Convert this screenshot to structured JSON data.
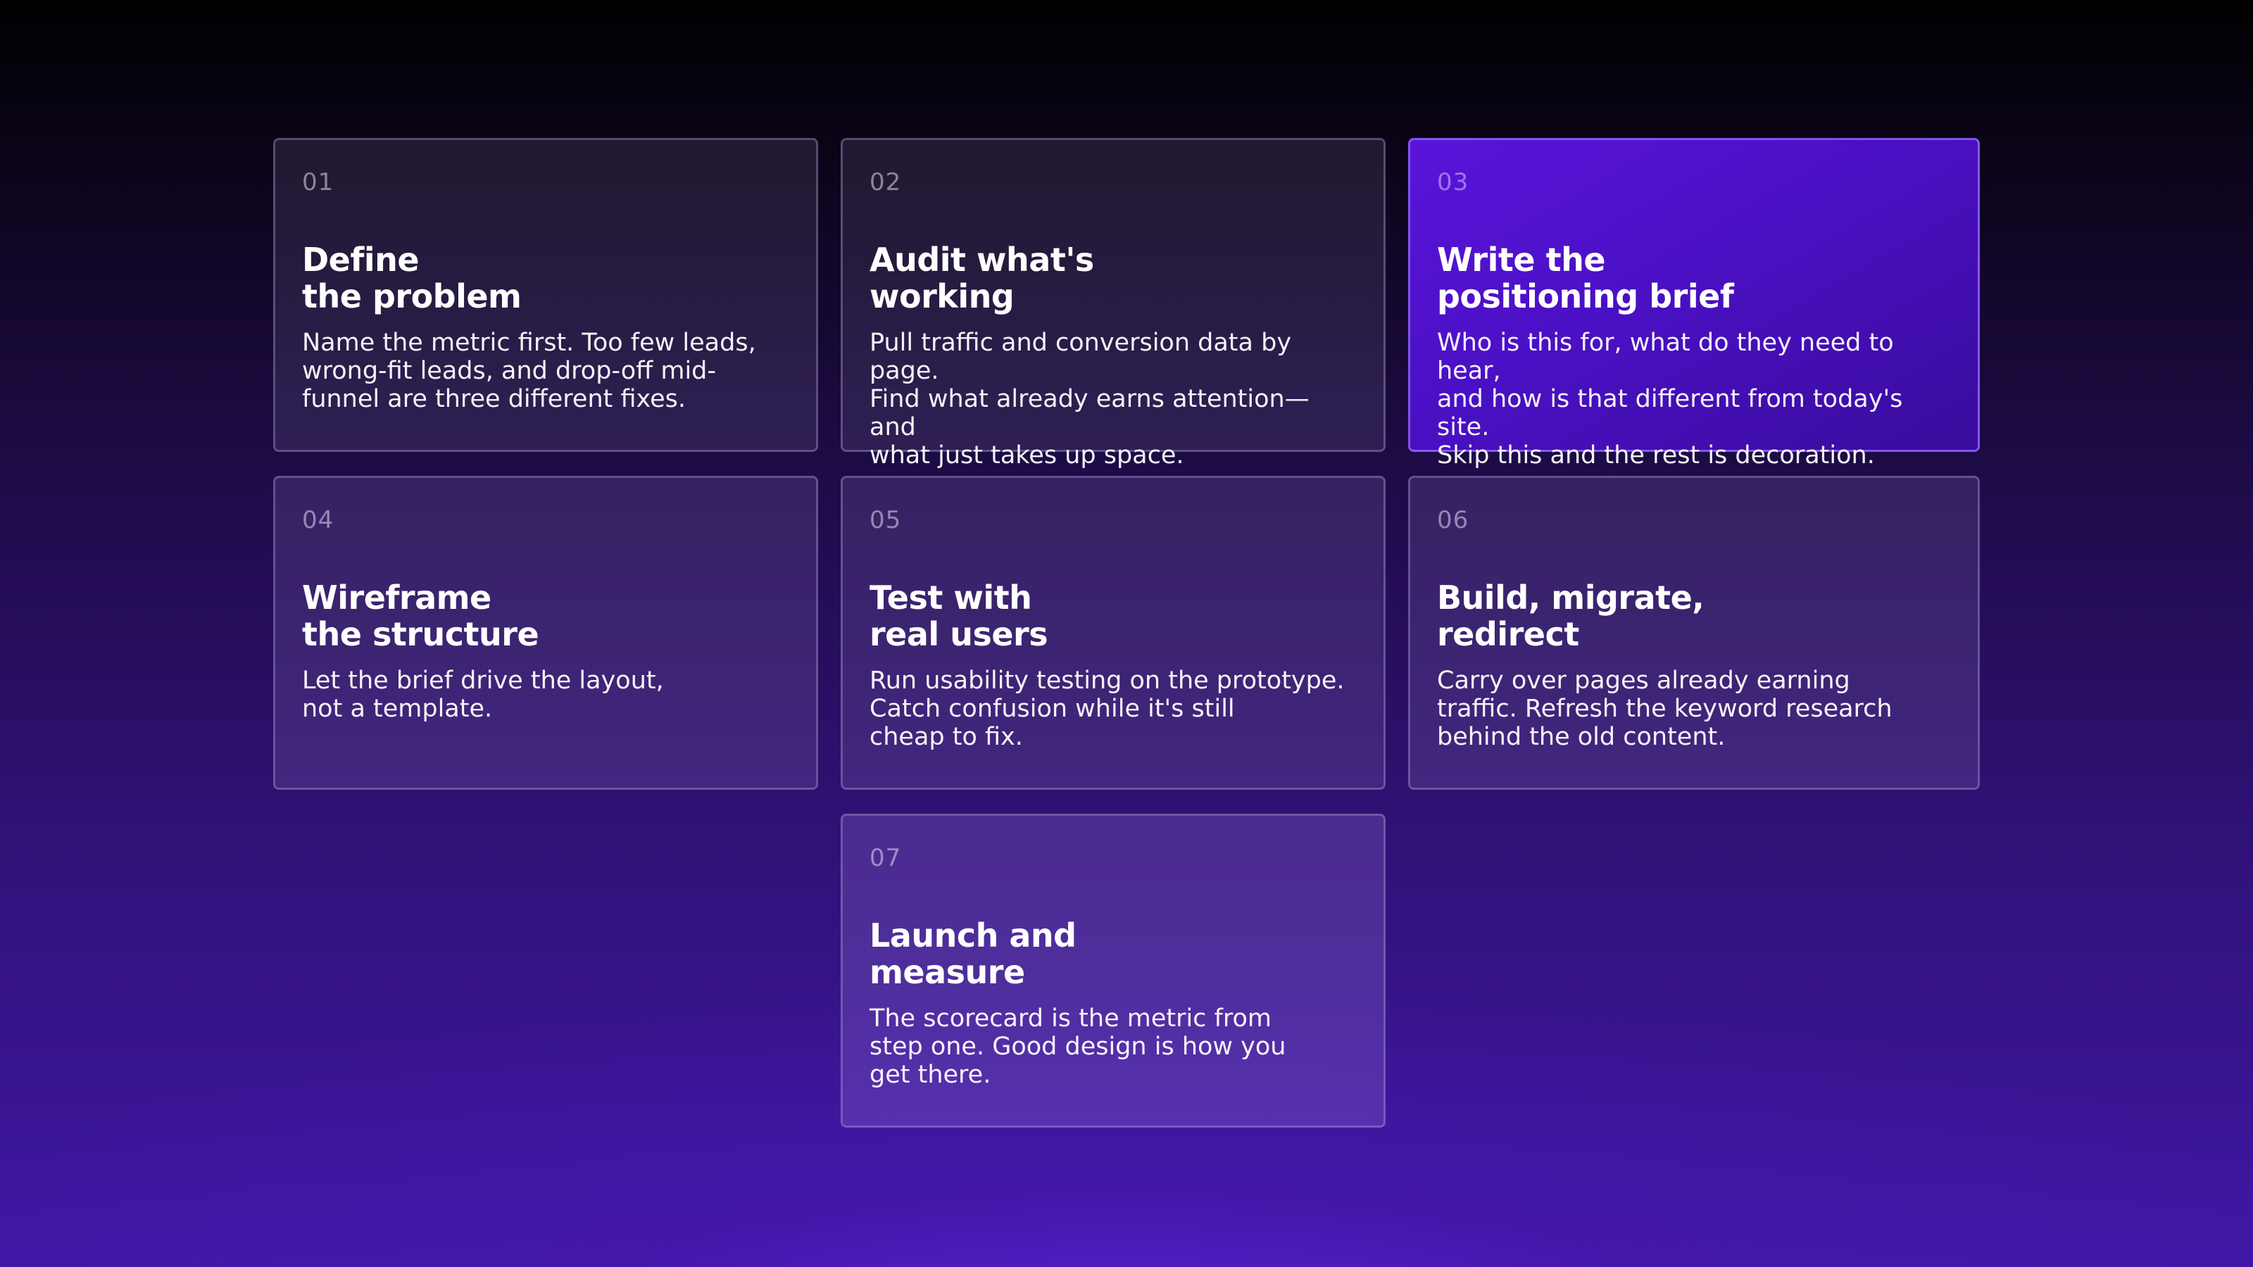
{
  "steps": [
    {
      "number": "01",
      "title": "Define\nthe problem",
      "body": "Name the metric first. Too few leads,\nwrong-fit leads, and drop-off mid-\nfunnel are three different fixes."
    },
    {
      "number": "02",
      "title": "Audit what's\nworking",
      "body": "Pull traffic and conversion data by page.\nFind what already earns attention—and\nwhat just takes up space."
    },
    {
      "number": "03",
      "title": "Write the\npositioning brief",
      "body": "Who is this for, what do they need to hear,\nand how is that different from today's site.\nSkip this and the rest is decoration."
    },
    {
      "number": "04",
      "title": "Wireframe\nthe structure",
      "body": "Let the brief drive the layout,\nnot a template."
    },
    {
      "number": "05",
      "title": "Test with\nreal users",
      "body": "Run usability testing on the prototype.\nCatch confusion while it's still\ncheap to fix."
    },
    {
      "number": "06",
      "title": "Build, migrate,\nredirect",
      "body": "Carry over pages already earning\ntraffic. Refresh the keyword research\nbehind the old content."
    },
    {
      "number": "07",
      "title": "Launch and\nmeasure",
      "body": "The scorecard is the metric from\nstep one. Good design is how you\nget there."
    }
  ],
  "colors": {
    "accent_card": "#5a14da",
    "card_border": "#a096c8",
    "background_bottom": "#3f18a6"
  }
}
